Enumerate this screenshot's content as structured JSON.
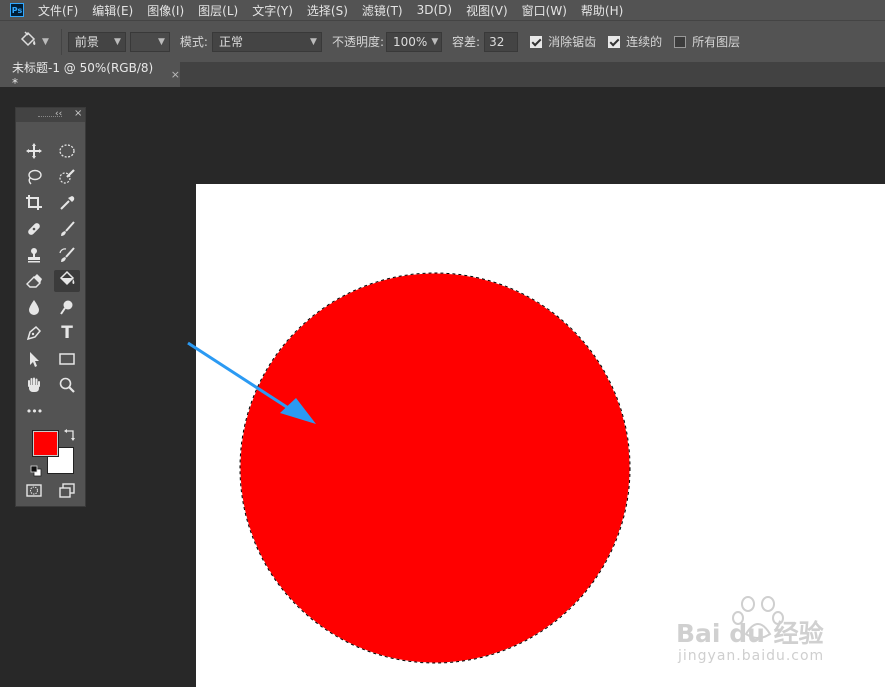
{
  "app": {
    "logo": "Ps"
  },
  "menu": [
    "文件(F)",
    "编辑(E)",
    "图像(I)",
    "图层(L)",
    "文字(Y)",
    "选择(S)",
    "滤镜(T)",
    "3D(D)",
    "视图(V)",
    "窗口(W)",
    "帮助(H)"
  ],
  "options": {
    "tool_icon": "paint-bucket-icon",
    "fill_source": "前景",
    "mode_label": "模式:",
    "mode_value": "正常",
    "opacity_label": "不透明度:",
    "opacity_value": "100%",
    "tolerance_label": "容差:",
    "tolerance_value": "32",
    "antialias_label": "消除锯齿",
    "antialias_checked": true,
    "contiguous_label": "连续的",
    "contiguous_checked": true,
    "all_layers_label": "所有图层",
    "all_layers_checked": false
  },
  "document_tab": {
    "title": "未标题-1 @ 50%(RGB/8) *",
    "close": "×"
  },
  "toolbox": {
    "header_collapse": "‹‹",
    "header_close": "×",
    "tools": [
      "move-icon",
      "elliptical-marquee-icon",
      "lasso-icon",
      "quick-selection-icon",
      "crop-icon",
      "eyedropper-icon",
      "healing-brush-icon",
      "brush-icon",
      "clone-stamp-icon",
      "history-brush-icon",
      "eraser-icon",
      "paint-bucket-icon",
      "blur-icon",
      "dodge-icon",
      "pen-icon",
      "type-icon",
      "path-selection-icon",
      "rectangle-icon",
      "hand-icon",
      "zoom-icon",
      "more-tools-icon"
    ],
    "type_tool_glyph": "T",
    "more_glyph": "•••",
    "active_tool": "paint-bucket-icon",
    "foreground_color": "#ff0000",
    "background_color": "#ffffff"
  },
  "canvas": {
    "background": "#ffffff",
    "circle_fill": "#ff0000",
    "annotation_arrow_color": "#2b9af3"
  },
  "watermark": {
    "brand_text": "Bai du 经验",
    "url_text": "jingyan.baidu.com"
  }
}
